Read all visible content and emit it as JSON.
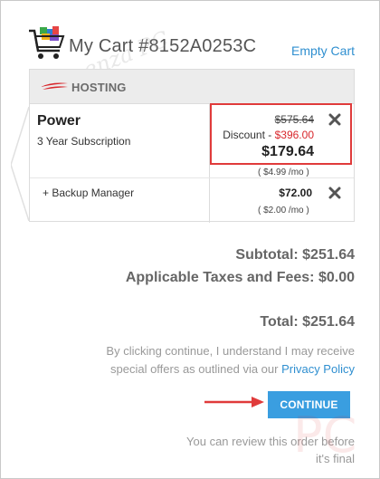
{
  "header": {
    "title": "My Cart #8152A0253C",
    "empty_cart_label": "Empty Cart"
  },
  "watermark": {
    "text": "Vlamenza PC",
    "pc_text": "PC"
  },
  "section": {
    "label": "HOSTING"
  },
  "product": {
    "name": "Power",
    "term": "3 Year Subscription",
    "original_price": "$575.64",
    "discount_label": "Discount - ",
    "discount_value": "$396.00",
    "final_price": "$179.64",
    "per_month": "( $4.99 /mo )"
  },
  "addon": {
    "name": "+ Backup Manager",
    "price": "$72.00",
    "per_month": "( $2.00 /mo )"
  },
  "totals": {
    "subtotal": "Subtotal: $251.64",
    "taxes": "Applicable Taxes and Fees: $0.00",
    "total": "Total: $251.64"
  },
  "agreement": {
    "text": "By clicking continue, I understand I may receive special offers as outlined via our ",
    "link": "Privacy Policy"
  },
  "continue_label": "CONTINUE",
  "review_text": "You can review this order before it's final",
  "colors": {
    "link": "#2f8fd0",
    "button": "#3a9ee0",
    "discount": "#d8262b",
    "highlight": "#e03b3b"
  }
}
